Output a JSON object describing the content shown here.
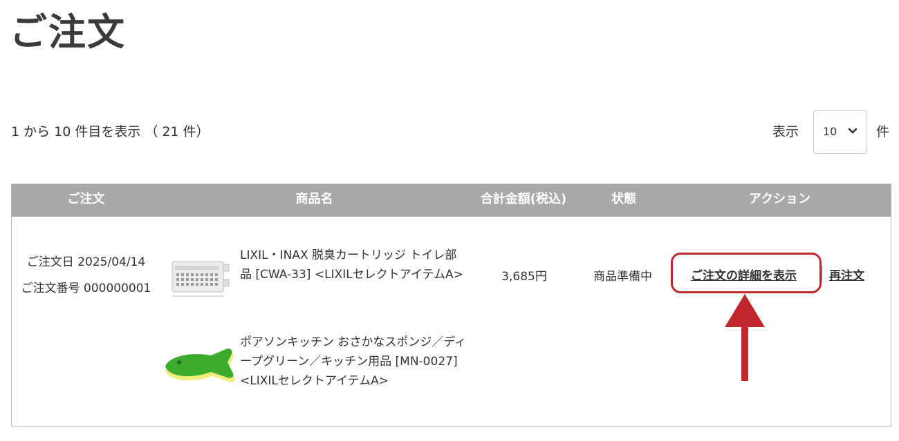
{
  "page": {
    "title": "ご注文"
  },
  "pagination": {
    "summary": "1 から 10 件目を表示 （ 21 件）",
    "per_page_label": "表示",
    "per_page_value": "10",
    "per_page_unit": "件"
  },
  "table": {
    "headers": {
      "order": "ご注文",
      "product": "商品名",
      "total": "合計金額(税込)",
      "status": "状態",
      "action": "アクション"
    },
    "rows": [
      {
        "order_date": "ご注文日 2025/04/14",
        "order_number": "ご注文番号 000000001",
        "products": [
          {
            "name": "LIXIL・INAX 脱臭カートリッジ トイレ部品 [CWA-33] <LIXILセレクトアイテムA>",
            "thumb": "deodorizer-cartridge-image"
          },
          {
            "name": "ポアソンキッチン おさかなスポンジ／ディープグリーン／キッチン用品 [MN-0027] <LIXILセレクトアイテムA>",
            "thumb": "fish-sponge-image"
          }
        ],
        "total": "3,685円",
        "status": "商品準備中",
        "actions": {
          "detail": "ご注文の詳細を表示",
          "reorder": "再注文"
        }
      }
    ]
  },
  "annotation": {
    "color": "#c0272d"
  }
}
